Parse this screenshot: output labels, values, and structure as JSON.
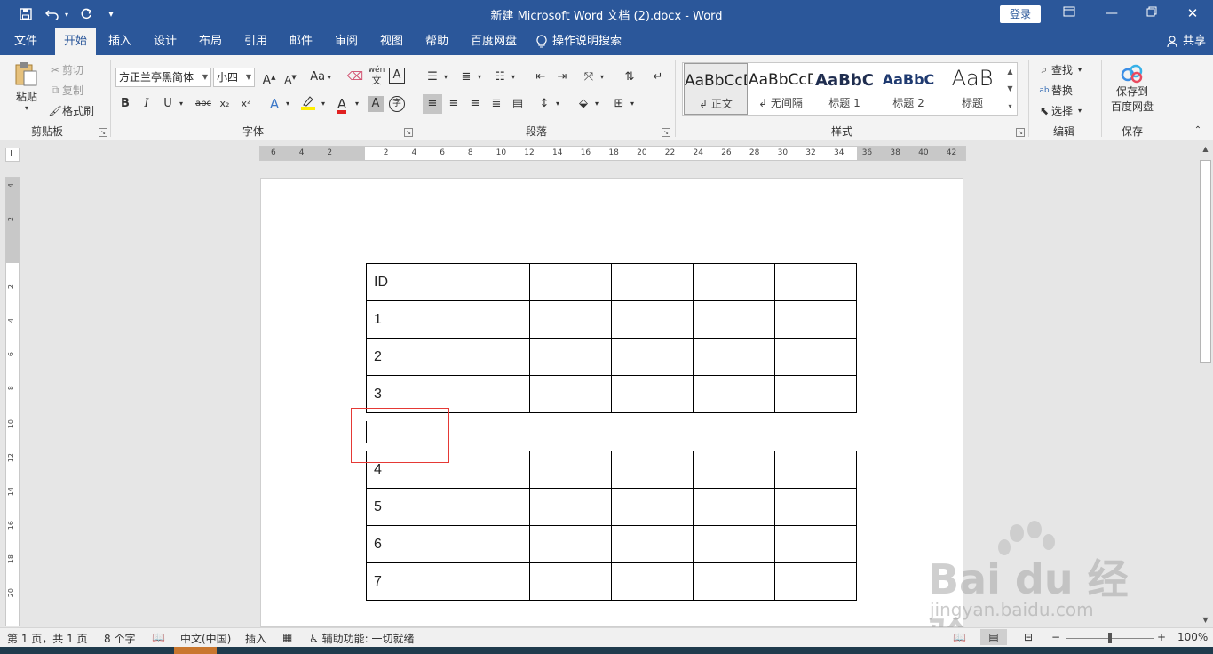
{
  "titlebar": {
    "title": "新建 Microsoft Word 文档 (2).docx  -  Word",
    "login_label": "登录",
    "qa_icons": [
      "save-icon",
      "undo-icon",
      "redo-icon",
      "customize-icon"
    ]
  },
  "menu": {
    "tabs": [
      "文件",
      "开始",
      "插入",
      "设计",
      "布局",
      "引用",
      "邮件",
      "审阅",
      "视图",
      "帮助",
      "百度网盘"
    ],
    "active_tab": "开始",
    "tell_me": "操作说明搜索",
    "share": "共享"
  },
  "ribbon": {
    "clipboard": {
      "paste": "粘贴",
      "cut": "剪切",
      "copy": "复制",
      "format_painter": "格式刷",
      "label": "剪贴板"
    },
    "font": {
      "font_name": "方正兰亭黑简体",
      "font_size": "小四",
      "grow": "A",
      "shrink": "A",
      "change_case": "Aa",
      "bold": "B",
      "italic": "I",
      "underline": "U",
      "strike": "abc",
      "subscript": "x₂",
      "superscript": "x²",
      "phonetic": "wén",
      "char_border": "A",
      "font_color": "A",
      "char_shading": "A",
      "enclose": "字",
      "label": "字体"
    },
    "paragraph": {
      "label": "段落"
    },
    "styles": {
      "items": [
        {
          "preview": "AaBbCcDd",
          "name": "正文"
        },
        {
          "preview": "AaBbCcDd",
          "name": "无间隔"
        },
        {
          "preview": "AaBbC",
          "name": "标题 1"
        },
        {
          "preview": "AaBbC",
          "name": "标题 2"
        },
        {
          "preview": "AaB",
          "name": "标题"
        }
      ],
      "label": "样式"
    },
    "editing": {
      "find": "查找",
      "replace": "替换",
      "select": "选择",
      "label": "编辑"
    },
    "save": {
      "save_to": "保存到",
      "baidu": "百度网盘",
      "label": "保存"
    }
  },
  "ruler": {
    "h_ticks": [
      "6",
      "4",
      "2",
      "",
      "2",
      "4",
      "6",
      "8",
      "10",
      "12",
      "14",
      "16",
      "18",
      "20",
      "22",
      "24",
      "26",
      "28",
      "30",
      "32",
      "34",
      "36",
      "38",
      "40",
      "42"
    ],
    "v_ticks": [
      "4",
      "2",
      "",
      "2",
      "4",
      "6",
      "8",
      "10",
      "12",
      "14",
      "16",
      "18",
      "20"
    ],
    "corner": "L"
  },
  "document": {
    "table1": {
      "rows": [
        [
          "ID",
          "",
          "",
          "",
          "",
          ""
        ],
        [
          "1",
          "",
          "",
          "",
          "",
          ""
        ],
        [
          "2",
          "",
          "",
          "",
          "",
          ""
        ],
        [
          "3",
          "",
          "",
          "",
          "",
          ""
        ]
      ]
    },
    "table2": {
      "rows": [
        [
          "4",
          "",
          "",
          "",
          "",
          ""
        ],
        [
          "5",
          "",
          "",
          "",
          "",
          ""
        ],
        [
          "6",
          "",
          "",
          "",
          "",
          ""
        ],
        [
          "7",
          "",
          "",
          "",
          "",
          ""
        ]
      ]
    }
  },
  "statusbar": {
    "page": "第 1 页，共 1 页",
    "words": "8 个字",
    "language": "中文(中国)",
    "mode": "插入",
    "accessibility": "辅助功能: 一切就绪",
    "zoom": "100%",
    "zoom_level": 1.0
  },
  "watermark": {
    "brand": "Bai du 经验",
    "url": "jingyan.baidu.com"
  },
  "colors": {
    "brand": "#2b579a",
    "ribbon_bg": "#f3f3f3",
    "highlight_box": "#e53935"
  }
}
